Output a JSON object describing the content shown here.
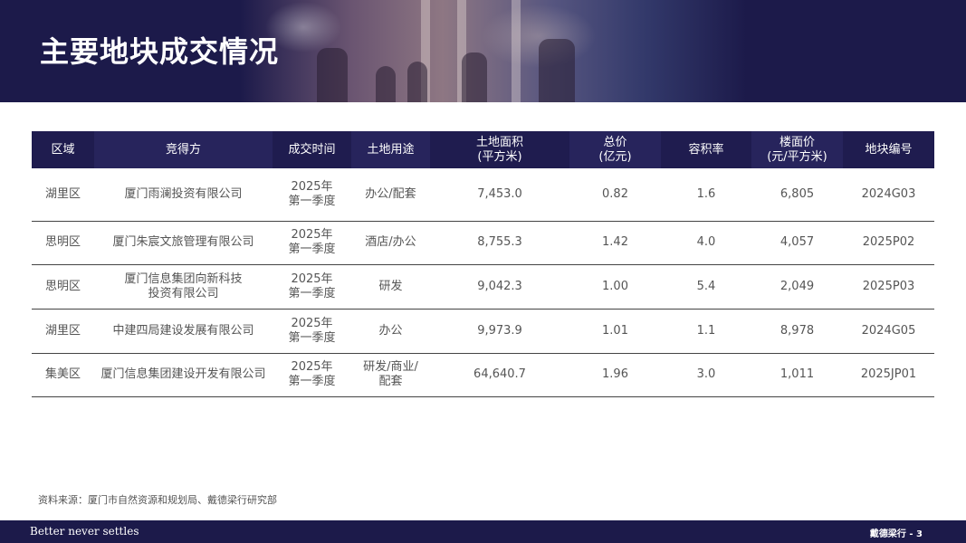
{
  "page": {
    "title": "主要地块成交情况",
    "source": "资料来源：厦门市自然资源和规划局、戴德梁行研究部",
    "tagline": "Better never settles",
    "footer_brand": "戴德梁行",
    "footer_separator": " - ",
    "page_number": "3"
  },
  "table": {
    "headers": [
      [
        "区域"
      ],
      [
        "竞得方"
      ],
      [
        "成交时间"
      ],
      [
        "土地用途"
      ],
      [
        "土地面积",
        "(平方米)"
      ],
      [
        "总价",
        "(亿元)"
      ],
      [
        "容积率"
      ],
      [
        "楼面价",
        "(元/平方米)"
      ],
      [
        "地块编号"
      ]
    ],
    "rows": [
      [
        [
          "湖里区"
        ],
        [
          "厦门雨澜投资有限公司"
        ],
        [
          "2025年",
          "第一季度"
        ],
        [
          "办公/配套"
        ],
        [
          "7,453.0"
        ],
        [
          "0.82"
        ],
        [
          "1.6"
        ],
        [
          "6,805"
        ],
        [
          "2024G03"
        ]
      ],
      [
        [
          "思明区"
        ],
        [
          "厦门朱宸文旅管理有限公司"
        ],
        [
          "2025年",
          "第一季度"
        ],
        [
          "酒店/办公"
        ],
        [
          "8,755.3"
        ],
        [
          "1.42"
        ],
        [
          "4.0"
        ],
        [
          "4,057"
        ],
        [
          "2025P02"
        ]
      ],
      [
        [
          "思明区"
        ],
        [
          "厦门信息集团向新科技",
          "投资有限公司"
        ],
        [
          "2025年",
          "第一季度"
        ],
        [
          "研发"
        ],
        [
          "9,042.3"
        ],
        [
          "1.00"
        ],
        [
          "5.4"
        ],
        [
          "2,049"
        ],
        [
          "2025P03"
        ]
      ],
      [
        [
          "湖里区"
        ],
        [
          "中建四局建设发展有限公司"
        ],
        [
          "2025年",
          "第一季度"
        ],
        [
          "办公"
        ],
        [
          "9,973.9"
        ],
        [
          "1.01"
        ],
        [
          "1.1"
        ],
        [
          "8,978"
        ],
        [
          "2024G05"
        ]
      ],
      [
        [
          "集美区"
        ],
        [
          "厦门信息集团建设开发有限公司"
        ],
        [
          "2025年",
          "第一季度"
        ],
        [
          "研发/商业/",
          "配套"
        ],
        [
          "64,640.7"
        ],
        [
          "1.96"
        ],
        [
          "3.0"
        ],
        [
          "1,011"
        ],
        [
          "2025JP01"
        ]
      ]
    ]
  }
}
